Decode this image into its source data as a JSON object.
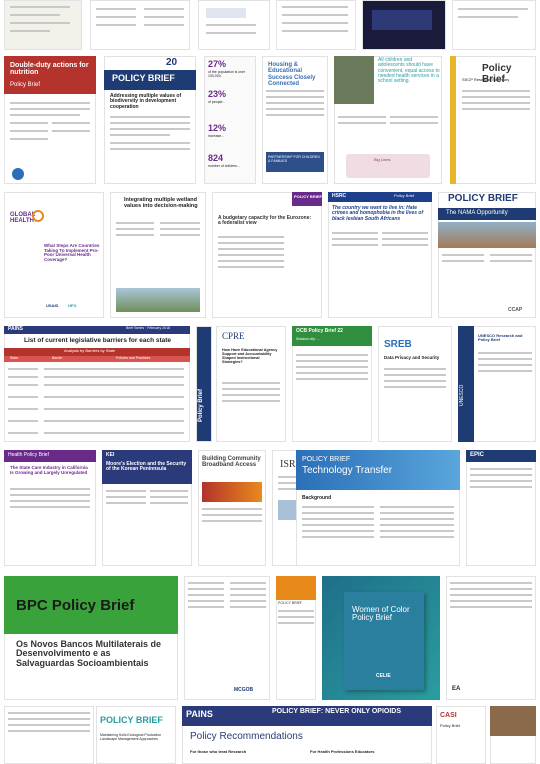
{
  "colors": {
    "nutrition_red": "#b4332d",
    "navy": "#1f3b73",
    "purple": "#6a2a8a",
    "teal": "#2a9d9f",
    "orange": "#e88a1a",
    "green": "#3aa23a",
    "pains_navy": "#2b3a7a",
    "ecc_blue": "#1d3f8c"
  },
  "row2": {
    "nutrition": {
      "title": "Double-duty actions for nutrition",
      "subtitle": "Policy Brief"
    },
    "addressing": {
      "number": "20",
      "title": "POLICY BRIEF",
      "subtitle": "Addressing multiple values of biodiversity in development cooperation"
    },
    "stats": {
      "items": [
        {
          "value": "27%",
          "label": "of the population is over 100,000"
        },
        {
          "value": "23%",
          "label": "of people..."
        },
        {
          "value": "12%",
          "label": "increase..."
        },
        {
          "value": "824",
          "label": "number of children..."
        }
      ]
    },
    "housing": {
      "title": "Housing & Educational Success Closely Connected",
      "footer": "PARTNERSHIP FOR CHILDREN & FAMILIES"
    },
    "adolescents": {
      "quote": "All children and adolescents should have convenient, equal access to needed health services in a school setting.",
      "label": "Big Lines"
    },
    "sscp": {
      "title": "Policy Brief",
      "subtitle": "SSCP Research Summary"
    }
  },
  "row3": {
    "globalhealth": {
      "logo": "GLOBAL HEALTH",
      "title": "What Steps Are Countries Taking To Implement Pro-Poor Universal Health Coverage?",
      "sponsors": [
        "USAID",
        "HFG"
      ]
    },
    "wetland": {
      "title": "Integrating multiple wetland values into decision-making"
    },
    "budget": {
      "title": "A budgetary capacity for the Eurozone: a federalist view",
      "header": "POLICY BRIEF"
    },
    "hsrc": {
      "logo": "HSRC",
      "label": "Policy Brief",
      "title": "The country we want to live in: Hate crimes and homophobia in the lives of black lesbian South Africans"
    },
    "nama": {
      "title": "POLICY BRIEF",
      "subtitle": "The NAMA Opportunity",
      "footer": "CCAP"
    }
  },
  "row4": {
    "pains": {
      "header": "PAINS",
      "date": "Brief Series · February 2018",
      "title": "List of current legislative barriers for each state",
      "subtitle": "Analysis by Barriers by State",
      "col1": "State",
      "col2": "Barrier",
      "col3": "Policies and Practices"
    },
    "policybrief_v": {
      "label": "Policy Brief"
    },
    "cpre": {
      "logo": "CPRE",
      "title": "How Have Educational Agency Support and Accountability Shaped Instructional Strategies?"
    },
    "ocb": {
      "title": "OCB Policy Brief 22",
      "sub": "Shadow city: ..."
    },
    "sreb": {
      "logo": "SREB",
      "title": "Data Privacy and Security"
    },
    "unesco": {
      "logo": "UNESCO",
      "title": "UNESCO Research and Policy Brief"
    }
  },
  "row5": {
    "healthpolicy": {
      "label": "Health Policy Brief",
      "title": "The State Care Industry in California Is Growing and Largely Unregulated"
    },
    "moore": {
      "logo": "KEI",
      "title": "Moore's Election and the Security of the Korean Peninnsula"
    },
    "broadband": {
      "title": "Building Community Broadband Access"
    },
    "isr": {
      "logo": "ISR"
    },
    "tech": {
      "title": "POLICY BRIEF",
      "subtitle": "Technology Transfer",
      "section": "Background"
    },
    "epic": {
      "logo": "EPIC"
    }
  },
  "row6": {
    "bpc": {
      "title": "BPC Policy Brief",
      "subtitle": "Os Novos Bancos Multilaterais de Desenvolvimento e as Salvaguardas Socioambientais"
    },
    "mcgob": {
      "footer": "MCGOB"
    },
    "policybrief_small": {
      "title": "POLICY BRIEF"
    },
    "cele": {
      "title": "Women of Color Policy Brief",
      "logo": "CELIE"
    },
    "ea": {
      "logo": "EA"
    }
  },
  "row7": {
    "landscape": {
      "title": "POLICY BRIEF",
      "subtitle": "Maintaining Soils Ecological Production Landscape Management Approaches"
    },
    "painsopioids": {
      "header": "PAINS",
      "title": "POLICY BRIEF: NEVER ONLY OPIOIDS",
      "subtitle": "Policy Recommendations",
      "col1": "For those who treat Research",
      "col2": "For Health Professions Educators"
    },
    "casi": {
      "logo": "CASI",
      "label": "Policy Brief"
    }
  }
}
